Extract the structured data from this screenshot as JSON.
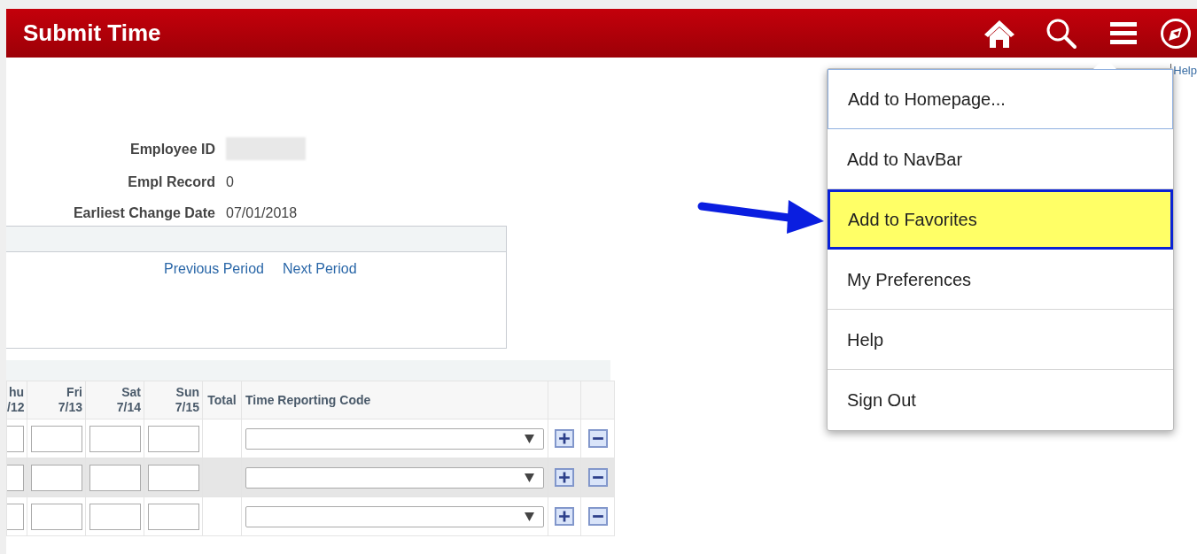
{
  "header": {
    "title": "Submit Time"
  },
  "top_link": "Help",
  "employee": [
    {
      "label": "Employee ID",
      "value_hidden": true
    },
    {
      "label": "Empl Record",
      "value": "0"
    },
    {
      "label": "Earliest Change Date",
      "value": "07/01/2018"
    }
  ],
  "period_links": [
    "Previous Period",
    "Next Period"
  ],
  "timesheet": {
    "columns": [
      {
        "label": "hu",
        "sub": "/12",
        "kind": "day"
      },
      {
        "label": "Fri",
        "sub": "7/13",
        "kind": "day"
      },
      {
        "label": "Sat",
        "sub": "7/14",
        "kind": "day"
      },
      {
        "label": "Sun",
        "sub": "7/15",
        "kind": "day"
      },
      {
        "label": "Total",
        "kind": "total"
      },
      {
        "label": "Time Reporting Code",
        "kind": "code"
      },
      {
        "kind": "add"
      },
      {
        "kind": "remove"
      }
    ],
    "row_count_rows": [
      {
        "shaded": false
      },
      {
        "shaded": true
      },
      {
        "shaded": false
      }
    ]
  },
  "menu": {
    "items": [
      {
        "label": "Add to Homepage...",
        "focused": true,
        "selected": false
      },
      {
        "label": "Add to NavBar",
        "focused": false,
        "selected": false
      },
      {
        "label": "Add to Favorites",
        "focused": false,
        "selected": true
      },
      {
        "label": "My Preferences",
        "focused": false,
        "selected": false
      },
      {
        "label": "Help",
        "focused": false,
        "selected": false
      },
      {
        "label": "Sign Out",
        "focused": false,
        "selected": false
      }
    ]
  }
}
